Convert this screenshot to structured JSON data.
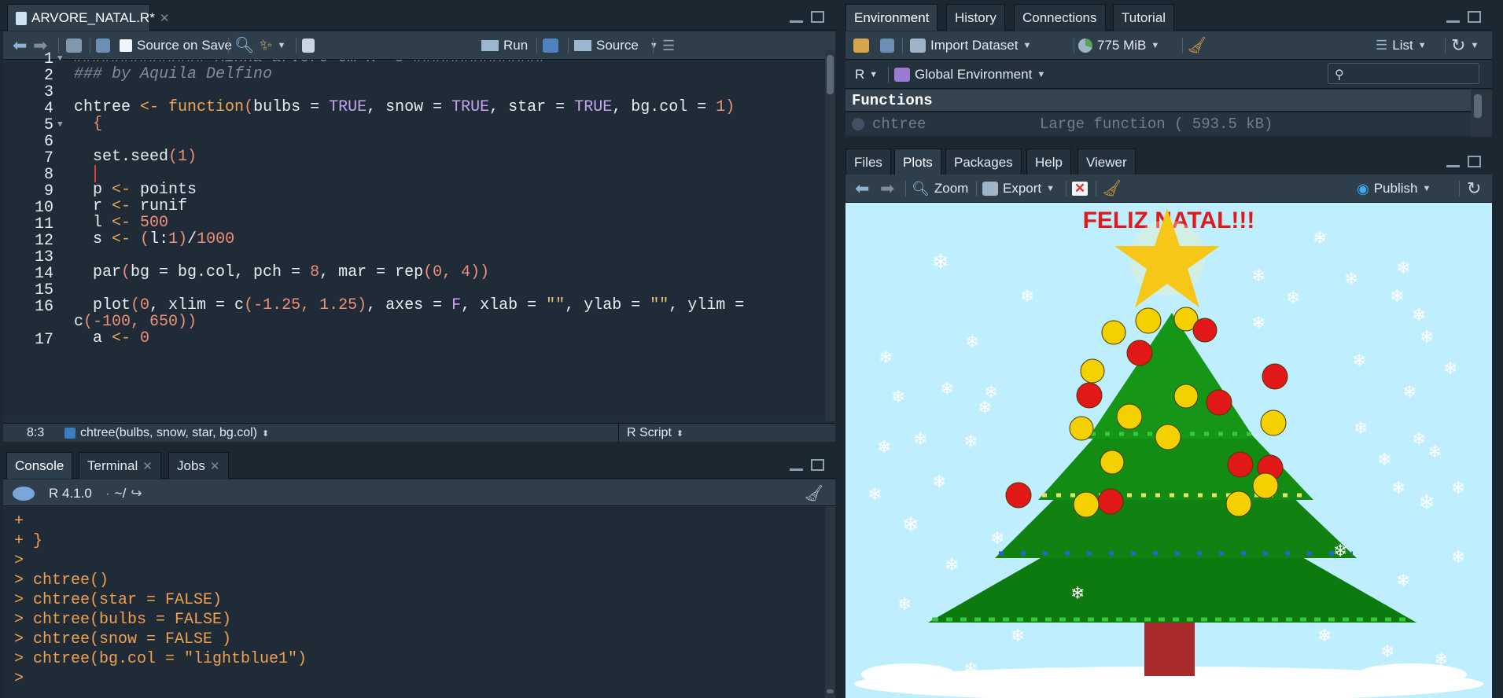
{
  "source_pane": {
    "file_tab": "ARVORE_NATAL.R*",
    "toolbar": {
      "source_on_save": "Source on Save",
      "run": "Run",
      "source": "Source"
    },
    "status": {
      "position": "8:3",
      "function": "chtree(bulbs, snow, star, bg.col)",
      "file_type": "R Script"
    },
    "line_numbers": [
      "1",
      "2",
      "3",
      "4",
      "5",
      "6",
      "7",
      "8",
      "9",
      "10",
      "11",
      "12",
      "13",
      "14",
      "15",
      "16",
      "",
      "17"
    ]
  },
  "console_pane": {
    "tabs": [
      "Console",
      "Terminal",
      "Jobs"
    ],
    "r_version": "R 4.1.0",
    "path": "~/",
    "lines": [
      "+",
      "+ }",
      ">",
      "> chtree()",
      "> chtree(star = FALSE)",
      "> chtree(bulbs = FALSE)",
      "> chtree(snow = FALSE )",
      "> chtree(bg.col = \"lightblue1\")",
      ">"
    ]
  },
  "env_pane": {
    "tabs": [
      "Environment",
      "History",
      "Connections",
      "Tutorial"
    ],
    "toolbar": {
      "import_dataset": "Import Dataset",
      "memory": "775 MiB",
      "view_mode": "List",
      "language": "R",
      "scope": "Global Environment"
    },
    "section_header": "Functions",
    "row": {
      "name": "chtree",
      "value": "Large function ( 593.5 kB)"
    }
  },
  "files_pane": {
    "tabs": [
      "Files",
      "Plots",
      "Packages",
      "Help",
      "Viewer"
    ],
    "toolbar": {
      "zoom": "Zoom",
      "export": "Export",
      "publish": "Publish"
    },
    "plot_title": "FELIZ NATAL!!!"
  },
  "colors": {
    "plot_background": "#bfefff",
    "tree": "#0f7a12",
    "trunk": "#a82a2a",
    "star": "#f6c619",
    "bulb_yellow": "#f5d000",
    "bulb_red": "#e01818",
    "title": "#e01a1a"
  }
}
